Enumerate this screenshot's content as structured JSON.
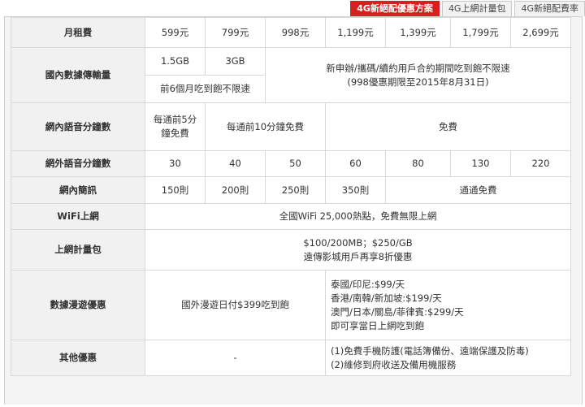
{
  "tabs": [
    {
      "label": "4G新絕配優惠方案",
      "active": true
    },
    {
      "label": "4G上網計量包",
      "active": false
    },
    {
      "label": "4G新絕配費率",
      "active": false
    }
  ],
  "plan_table": {
    "monthly_fee": {
      "label": "月租費",
      "values": [
        "599元",
        "799元",
        "998元",
        "1,199元",
        "1,399元",
        "1,799元",
        "2,699元"
      ]
    },
    "domestic_data": {
      "label": "國內數據傳輸量",
      "plan_599": "1.5GB",
      "plan_799": "3GB",
      "first_6_months": "前6個月吃到飽不限速",
      "unlimited_line1": "新申辦/攜碼/續約用戶合約期間吃到飽不限速",
      "unlimited_line2": "(998優惠期限至2015年8月31日)"
    },
    "onnet_voice": {
      "label": "網內語音分鐘數",
      "plan_599_line1": "每通前5分",
      "plan_599_line2": "鐘免費",
      "plan_799_998": "每通前10分鐘免費",
      "others": "免費"
    },
    "offnet_voice": {
      "label": "網外語音分鐘數",
      "values": [
        "30",
        "40",
        "50",
        "60",
        "80",
        "130",
        "220"
      ]
    },
    "onnet_sms": {
      "label": "網內簡訊",
      "values": [
        "150則",
        "200則",
        "250則",
        "350則"
      ],
      "others": "通通免費"
    },
    "wifi": {
      "label": "WiFi上網",
      "value": "全國WiFi 25,000熱點，免費無限上網"
    },
    "data_pack": {
      "label": "上網計量包",
      "line1": "$100/200MB；$250/GB",
      "line2": "遠傳影城用戶再享8折優惠"
    },
    "roaming": {
      "label": "數據漫遊優惠",
      "left": "國外漫遊日付$399吃到飽",
      "right_lines": [
        "泰國/印尼:$99/天",
        "香港/南韓/新加坡:$199/天",
        "澳門/日本/關島/菲律賓:$299/天",
        "即可享當日上網吃到飽"
      ]
    },
    "other": {
      "label": "其他優惠",
      "left": "-",
      "right_lines": [
        "(1)免費手機防護(電話簿備份、遠端保護及防毒)",
        "(2)維修到府收送及備用機服務"
      ]
    }
  },
  "colors": {
    "active_tab": "#d61f1f",
    "header_cell": "#f1f1f1",
    "border": "#d8d8d8",
    "frame_bg": "#f4f4f4"
  }
}
